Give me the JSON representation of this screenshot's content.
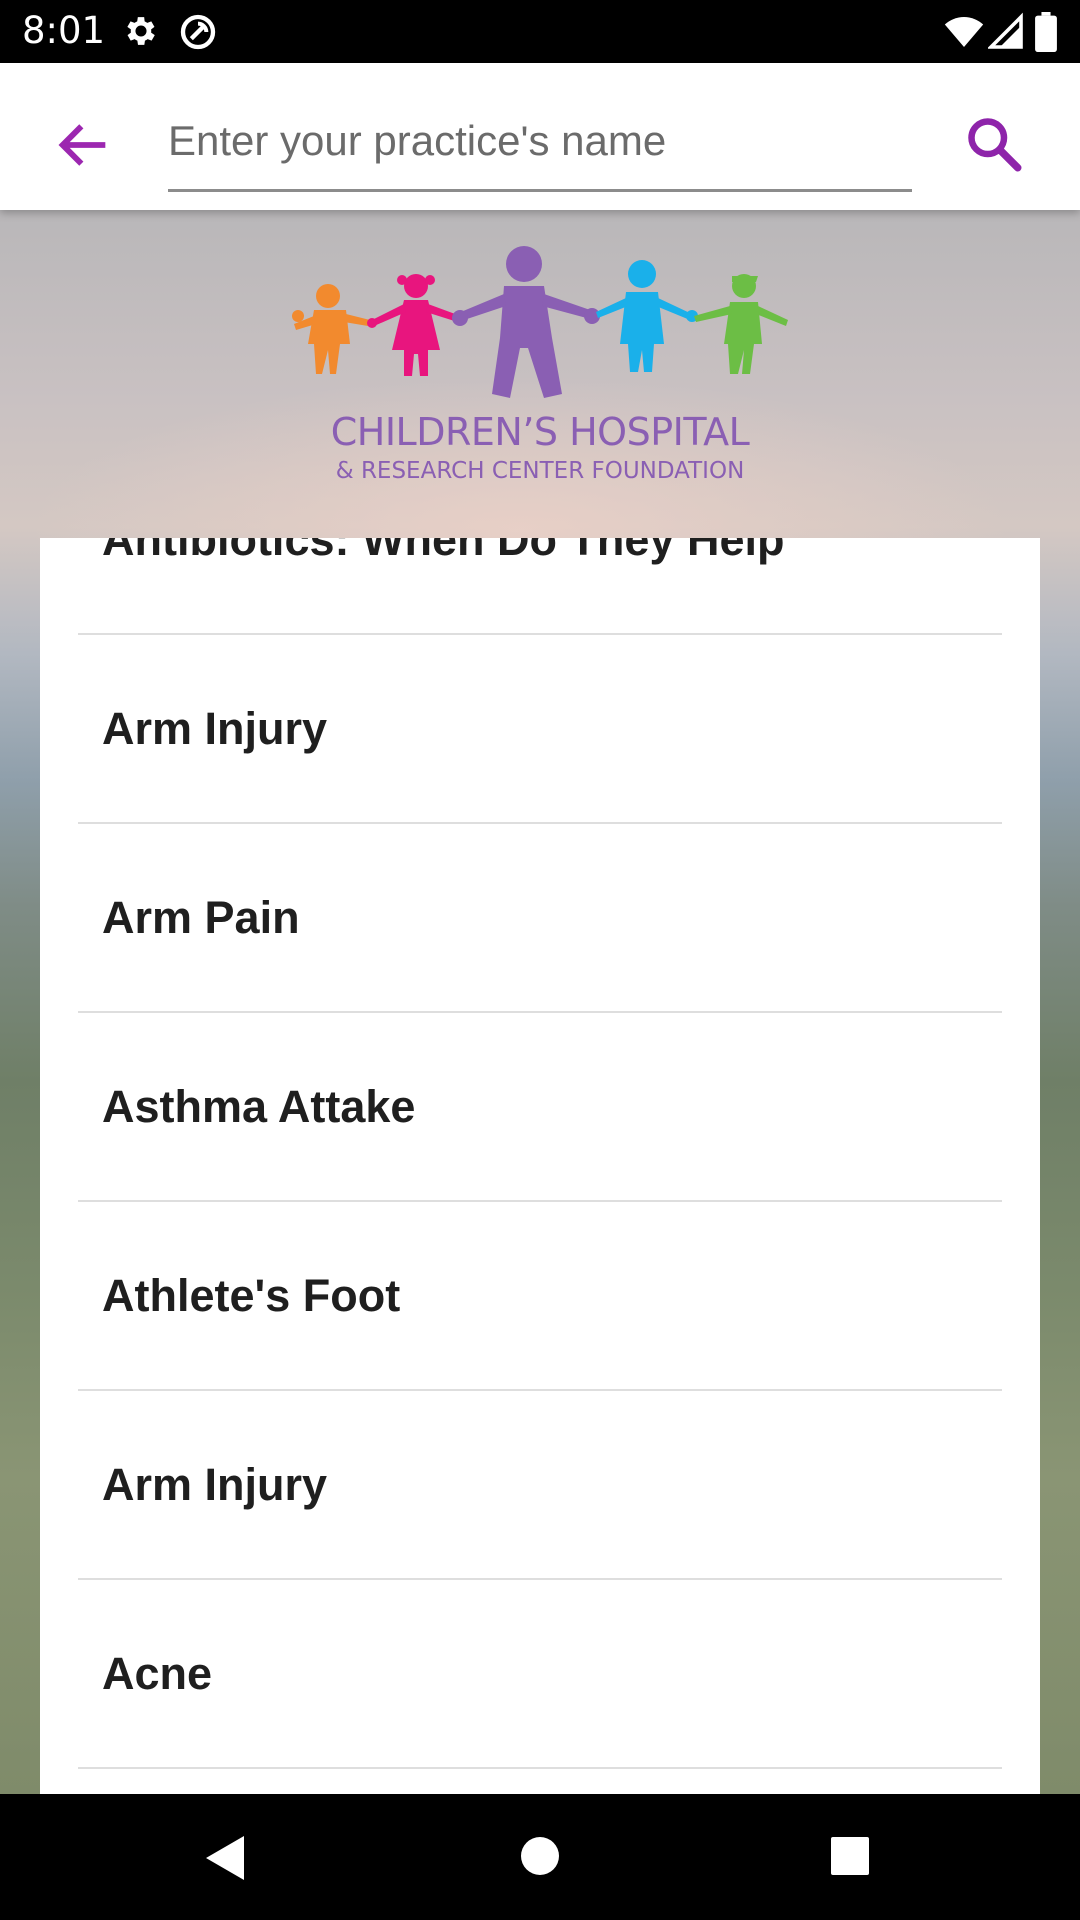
{
  "status_bar": {
    "time": "8:01"
  },
  "app_bar": {
    "search_placeholder": "Enter your practice's name"
  },
  "logo": {
    "title": "CHILDREN’S HOSPITAL",
    "subtitle": "& RESEARCH CENTER FOUNDATION"
  },
  "topics": [
    {
      "label": "Antibiotics: When Do They Help"
    },
    {
      "label": "Arm Injury"
    },
    {
      "label": "Arm Pain"
    },
    {
      "label": "Asthma Attake"
    },
    {
      "label": "Athlete's Foot"
    },
    {
      "label": "Arm Injury"
    },
    {
      "label": "Acne"
    },
    {
      "label": ""
    }
  ],
  "colors": {
    "accent": "#8e24aa",
    "logo_orange": "#f28a2e",
    "logo_pink": "#e8157e",
    "logo_purple": "#8a5fb3",
    "logo_blue": "#1ab0ea",
    "logo_green": "#6cbe45"
  }
}
